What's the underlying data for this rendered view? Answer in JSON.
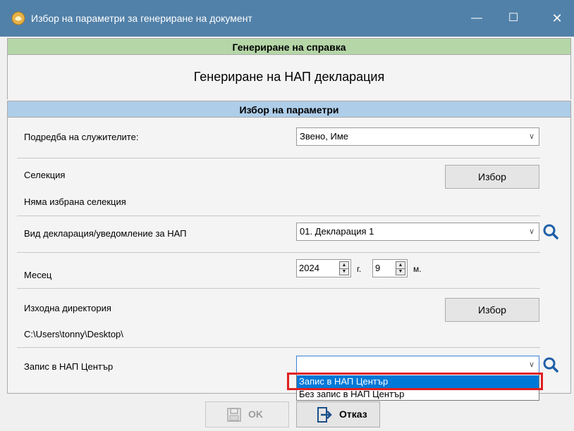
{
  "window": {
    "title": "Избор на параметри за генериране на документ",
    "min_glyph": "—",
    "max_glyph": "☐",
    "close_glyph": "✕"
  },
  "banners": {
    "report_header": "Генериране на справка",
    "report_title": "Генериране на НАП декларация",
    "params_header": "Избор на параметри"
  },
  "params": {
    "sort_label": "Подредба на служителите:",
    "sort_value": "Звено, Име",
    "selection_label": "Селекция",
    "selection_button": "Избор",
    "selection_status": "Няма избрана селекция",
    "decl_type_label": "Вид декларация/уведомление за НАП",
    "decl_type_value": "01. Декларация 1",
    "month_label": "Месец",
    "year_value": "2024",
    "year_unit": "г.",
    "month_value": "9",
    "month_unit": "м.",
    "out_dir_label": "Изходна директория",
    "out_dir_button": "Избор",
    "out_dir_value": "C:\\Users\\tonny\\Desktop\\",
    "nap_record_label": "Запис в НАП Център",
    "nap_record_value": ""
  },
  "dropdown": {
    "options": [
      "Запис в НАП Център",
      "Без запис в НАП Център"
    ],
    "selected_index": 0
  },
  "footer": {
    "ok_label": "OK",
    "cancel_label": "Отказ"
  },
  "colors": {
    "titlebar": "#5181a8",
    "banner_green": "#b5d7a8",
    "banner_blue": "#aecde8",
    "selection_blue": "#0078d7",
    "highlight_red": "#e02020"
  },
  "icons": [
    "app-icon",
    "chevron-down-icon",
    "search-icon",
    "floppy-disk-icon",
    "exit-arrow-icon"
  ]
}
